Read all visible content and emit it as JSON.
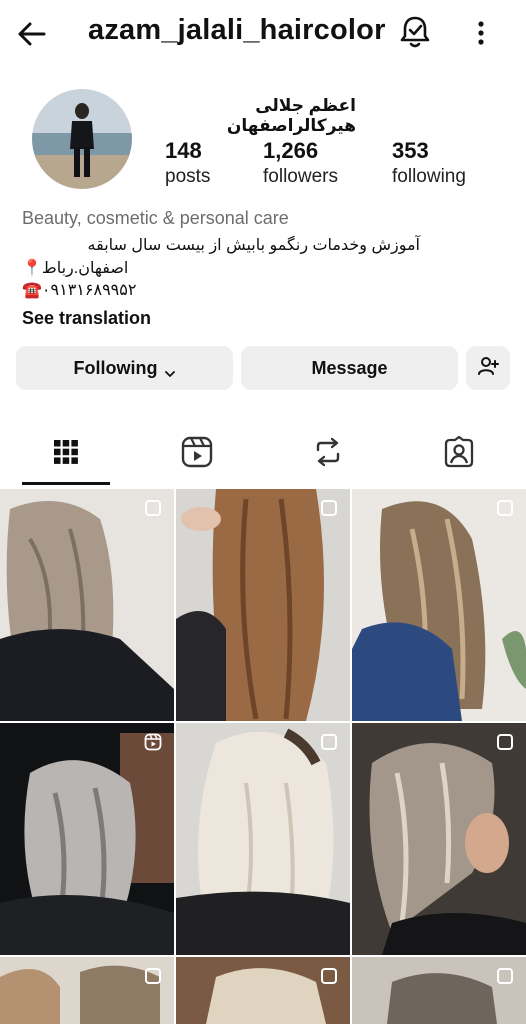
{
  "header": {
    "username": "azam_jalali_haircolor",
    "back_icon": "arrow-left-icon",
    "notify_icon": "bell-check-icon",
    "more_icon": "more-vertical-icon"
  },
  "profile": {
    "display_name": "اعظم جلالی هیرکالراصفهان",
    "stats": [
      {
        "value": "148",
        "label": "posts"
      },
      {
        "value": "1,266",
        "label": "followers"
      },
      {
        "value": "353",
        "label": "following"
      }
    ],
    "category": "Beauty, cosmetic & personal care",
    "bio_line1": "آموزش وخدمات رنگمو بابیش از بیست سال سابقه",
    "bio_line2_emoji": "📍",
    "bio_line2": "اصفهان.رباط",
    "bio_line3_emoji": "☎️",
    "bio_line3": "۰۹۱۳۱۶۸۹۹۵۲",
    "see_translation": "See translation"
  },
  "actions": {
    "following_label": "Following",
    "message_label": "Message",
    "add_user_icon": "add-person-icon"
  },
  "tabs": [
    {
      "icon": "grid-icon",
      "active": true
    },
    {
      "icon": "reels-icon",
      "active": false
    },
    {
      "icon": "reposts-icon",
      "active": false
    },
    {
      "icon": "tagged-icon",
      "active": false
    }
  ],
  "colors": {
    "button_bg": "#efefef",
    "category_text": "#6d6d6d"
  }
}
